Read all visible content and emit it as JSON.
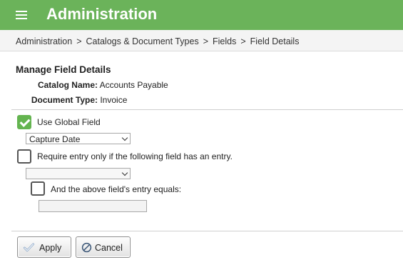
{
  "header": {
    "title": "Administration",
    "menu_icon": "hamburger-menu-icon",
    "color": "#6bb35a"
  },
  "breadcrumb": {
    "items": [
      "Administration",
      "Catalogs & Document Types",
      "Fields",
      "Field Details"
    ],
    "separator": ">"
  },
  "page": {
    "section_title": "Manage Field Details",
    "catalog_label": "Catalog Name:",
    "catalog_value": "Accounts Payable",
    "doctype_label": "Document Type:",
    "doctype_value": "Invoice"
  },
  "form": {
    "use_global": {
      "label": "Use Global Field",
      "checked": true
    },
    "global_field_select": {
      "value": "Capture Date"
    },
    "require_entry": {
      "label": "Require entry only if the following field has an entry.",
      "checked": false
    },
    "dependent_field_select": {
      "value": ""
    },
    "equals": {
      "label": "And the above field's entry equals:",
      "checked": false
    },
    "equals_value": ""
  },
  "actions": {
    "apply_label": "Apply",
    "apply_icon": "checkmark-icon",
    "cancel_label": "Cancel",
    "cancel_icon": "cancel-circle-icon"
  }
}
